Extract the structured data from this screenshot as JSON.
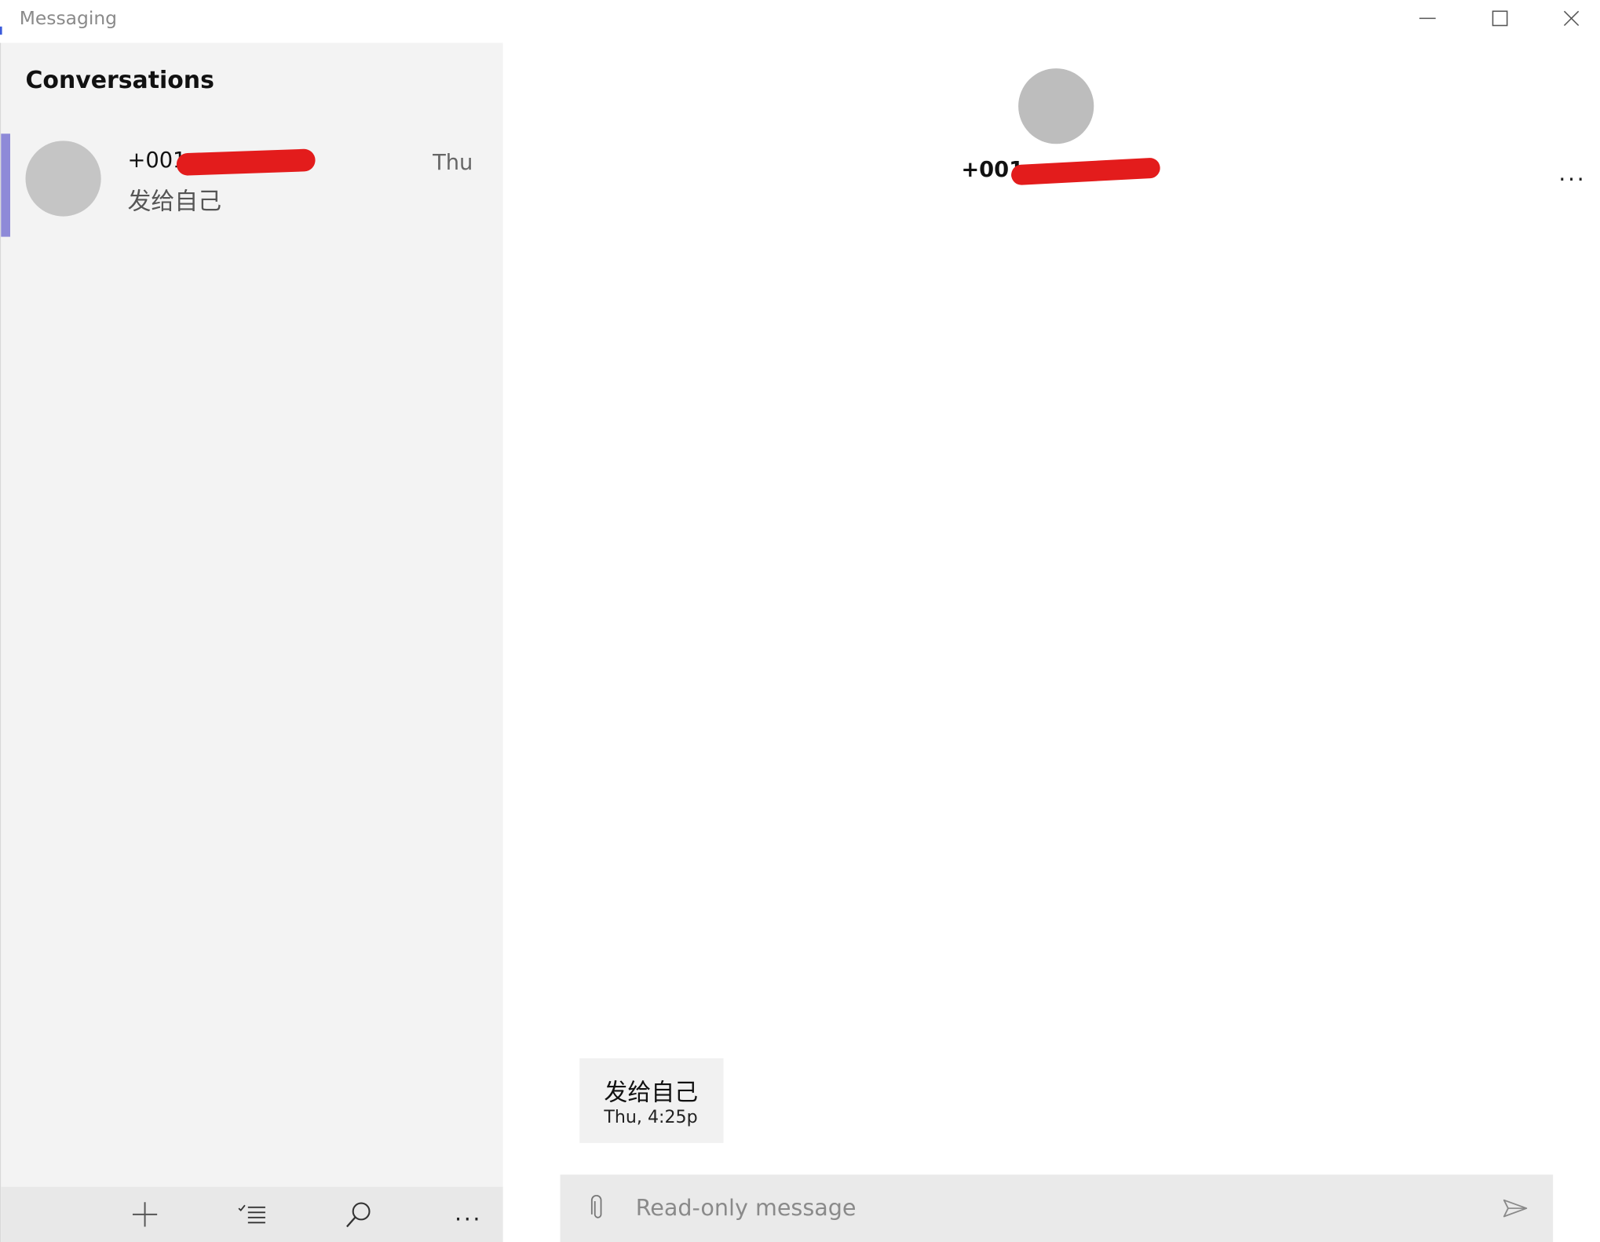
{
  "window": {
    "title": "Messaging"
  },
  "sidebar": {
    "heading": "Conversations",
    "conversations": [
      {
        "number_visible": "+001",
        "preview": "发给自己",
        "date": "Thu",
        "selected": true
      }
    ],
    "toolbar": {
      "icons": [
        "plus-icon",
        "select-list-icon",
        "search-icon",
        "more-icon"
      ],
      "more_label": "..."
    }
  },
  "main": {
    "contact_number_visible": "+001",
    "more_label": "...",
    "messages": [
      {
        "text": "发给自己",
        "time": "Thu, 4:25p"
      }
    ],
    "composer": {
      "placeholder": "Read-only message"
    }
  },
  "colors": {
    "selection_accent": "#8e8ad8",
    "sidebar_bg": "#f3f3f3",
    "avatar": "#c5c5c5",
    "redaction": "#e31c1c"
  }
}
